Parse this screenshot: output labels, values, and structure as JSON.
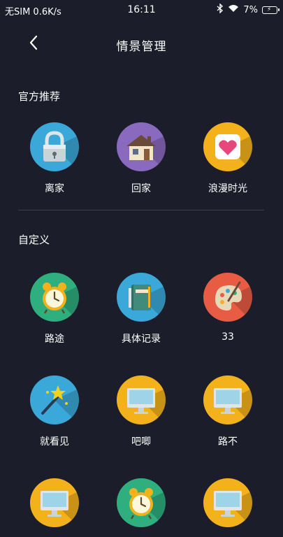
{
  "status": {
    "carrier": "无SIM 0.6K/s",
    "time": "16:11",
    "battery": "7%"
  },
  "header": {
    "title": "情景管理"
  },
  "sections": {
    "official": "官方推荐",
    "custom": "自定义"
  },
  "official_items": [
    {
      "label": "离家",
      "icon": "lock-icon",
      "color": "#3aa8d8"
    },
    {
      "label": "回家",
      "icon": "house-icon",
      "color": "#8a6abf"
    },
    {
      "label": "浪漫时光",
      "icon": "heart-icon",
      "color": "#f3b21b"
    }
  ],
  "custom_items": [
    {
      "label": "路途",
      "icon": "alarm-clock-icon",
      "color": "#2fae7e"
    },
    {
      "label": "具体记录",
      "icon": "notebook-icon",
      "color": "#3aa8d8"
    },
    {
      "label": "33",
      "icon": "palette-icon",
      "color": "#e85c44"
    },
    {
      "label": "就看见",
      "icon": "magic-wand-icon",
      "color": "#3aa8d8"
    },
    {
      "label": "吧唧",
      "icon": "monitor-icon",
      "color": "#f3b21b"
    },
    {
      "label": "路不",
      "icon": "monitor-icon",
      "color": "#f3b21b"
    },
    {
      "label": "",
      "icon": "monitor-icon",
      "color": "#f3b21b"
    },
    {
      "label": "",
      "icon": "alarm-clock-icon",
      "color": "#2fae7e"
    },
    {
      "label": "",
      "icon": "monitor-icon",
      "color": "#f3b21b"
    }
  ]
}
